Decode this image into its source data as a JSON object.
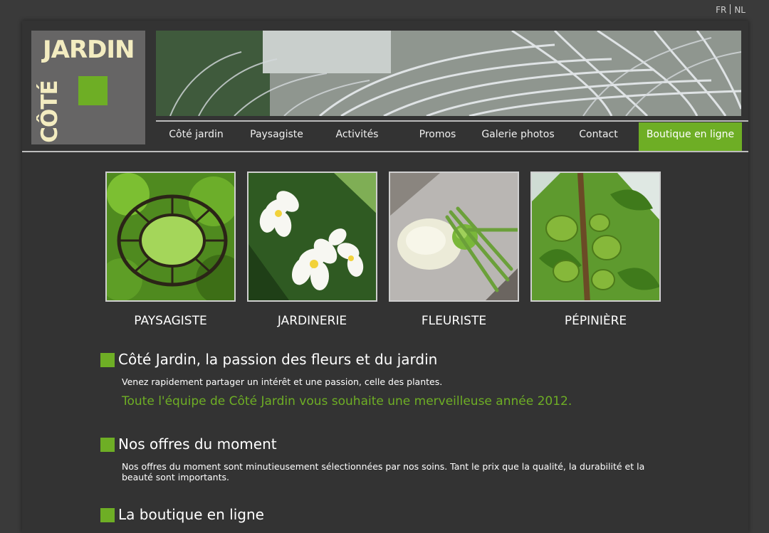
{
  "lang": {
    "fr": "FR",
    "nl": "NL"
  },
  "logo": {
    "line1": "JARDIN",
    "line2": "CÔTÉ"
  },
  "nav": [
    {
      "label": "Côté jardin"
    },
    {
      "label": "Paysagiste"
    },
    {
      "label": "Activités"
    },
    {
      "label": "Promos"
    },
    {
      "label": "Galerie photos"
    },
    {
      "label": "Contact"
    },
    {
      "label": "Boutique en ligne"
    }
  ],
  "categories": [
    {
      "label": "PAYSAGISTE",
      "image": "gazebo-foliage-photo"
    },
    {
      "label": "JARDINERIE",
      "image": "frangipani-flowers-photo"
    },
    {
      "label": "FLEURISTE",
      "image": "calla-arrangement-photo"
    },
    {
      "label": "PÉPINIÈRE",
      "image": "fig-tree-photo"
    }
  ],
  "sections": [
    {
      "title": "Côté Jardin, la passion des fleurs et du jardin",
      "text": "Venez rapidement partager un intérêt et une passion, celle des plantes.",
      "highlight": "Toute l'équipe de Côté Jardin vous souhaite une merveilleuse année 2012."
    },
    {
      "title": "Nos offres du moment",
      "text": "Nos offres du moment sont minutieusement sélectionnées par nos soins. Tant le prix que la qualité, la durabilité et la beauté sont importants."
    },
    {
      "title": "La boutique en ligne"
    }
  ],
  "colors": {
    "accent": "#6eae25",
    "background": "#333333",
    "page": "#3a3a3a",
    "logo_bg": "#666565",
    "logo_text": "#f3ecc0"
  }
}
